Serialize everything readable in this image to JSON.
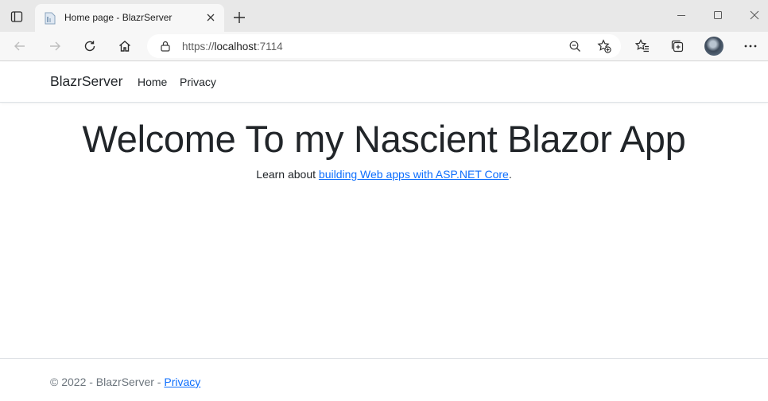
{
  "browser": {
    "tab": {
      "title": "Home page - BlazrServer"
    },
    "address": {
      "protocol": "https://",
      "host": "localhost",
      "port": ":7114"
    }
  },
  "navbar": {
    "brand": "BlazrServer",
    "links": [
      {
        "label": "Home"
      },
      {
        "label": "Privacy"
      }
    ]
  },
  "main": {
    "heading": "Welcome To my Nascient Blazor App",
    "lead_prefix": "Learn about ",
    "lead_link": "building Web apps with ASP.NET Core",
    "lead_suffix": "."
  },
  "footer": {
    "copyright": "© 2022 - BlazrServer - ",
    "privacy_link": "Privacy"
  },
  "colors": {
    "link": "#0d6efd",
    "text": "#212529",
    "muted": "#6c757d",
    "chrome_tabstrip": "#e8e8e8",
    "chrome_toolbar": "#f7f7f7"
  }
}
